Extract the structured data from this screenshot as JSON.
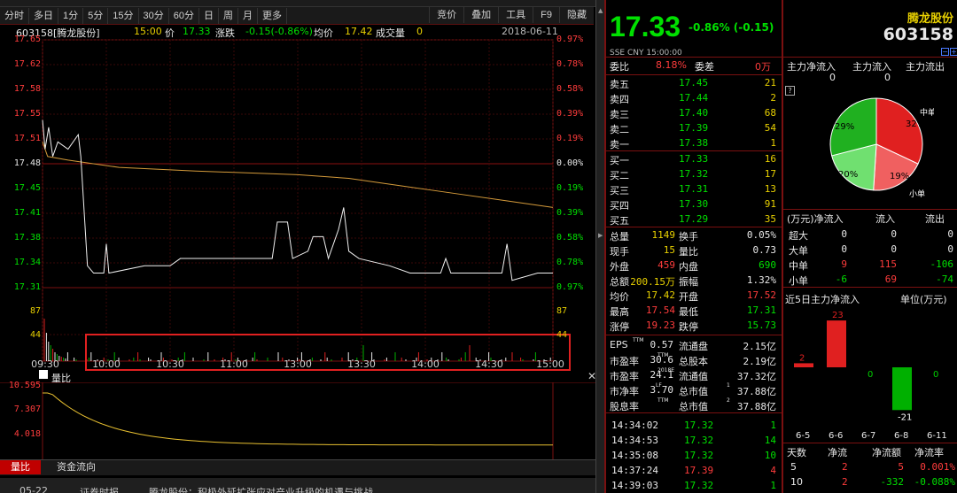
{
  "toolbar": {
    "left": [
      "分时",
      "多日",
      "1分",
      "5分",
      "15分",
      "30分",
      "60分",
      "日",
      "周",
      "月",
      "更多"
    ],
    "right": [
      "竞价",
      "叠加",
      "工具",
      "F9",
      "隐藏"
    ]
  },
  "info": {
    "code_name": "603158[腾龙股份]",
    "time": "15:00",
    "price_label": "价",
    "price": "17.33",
    "change_label": "涨跌",
    "change": "-0.15(-0.86%)",
    "avg_label": "均价",
    "avg": "17.42",
    "vol_label": "成交量",
    "vol": "0",
    "date": "2018-06-11"
  },
  "price_axis": {
    "left": [
      "17.65",
      "17.62",
      "17.58",
      "17.55",
      "17.51",
      "17.48",
      "17.45",
      "17.41",
      "17.38",
      "17.34",
      "17.31"
    ],
    "right": [
      "0.97%",
      "0.78%",
      "0.58%",
      "0.39%",
      "0.19%",
      "0.00%",
      "0.19%",
      "0.39%",
      "0.58%",
      "0.78%",
      "0.97%"
    ]
  },
  "volume_axis": {
    "left": [
      "87",
      "44"
    ],
    "right": [
      "87",
      "44"
    ]
  },
  "time_axis": [
    "09:30",
    "10:00",
    "10:30",
    "11:00",
    "13:00",
    "13:30",
    "14:00",
    "14:30",
    "15:00"
  ],
  "sub_chart": {
    "title": "量比",
    "ticks": [
      "10.595",
      "7.307",
      "4.018"
    ]
  },
  "bottom_tabs": [
    "量比",
    "资金流向"
  ],
  "news_strip": {
    "time": "05-22",
    "col": "证券时报",
    "text": "腾龙股份：积极外延扩张应对产业升级的机遇与挑战"
  },
  "quote": {
    "price": "17.33",
    "change": "-0.86% (-0.15)",
    "name": "腾龙股份",
    "code": "603158",
    "meta": "SSE  CNY   15:00:00",
    "weibi_label": "委比",
    "weibi": "8.18%",
    "weicha_label": "委差",
    "weicha": "0万"
  },
  "asks": [
    {
      "label": "卖五",
      "price": "17.45",
      "vol": "21"
    },
    {
      "label": "卖四",
      "price": "17.44",
      "vol": "2"
    },
    {
      "label": "卖三",
      "price": "17.40",
      "vol": "68"
    },
    {
      "label": "卖二",
      "price": "17.39",
      "vol": "54"
    },
    {
      "label": "卖一",
      "price": "17.38",
      "vol": "1"
    }
  ],
  "bids": [
    {
      "label": "买一",
      "price": "17.33",
      "vol": "16"
    },
    {
      "label": "买二",
      "price": "17.32",
      "vol": "17"
    },
    {
      "label": "买三",
      "price": "17.31",
      "vol": "13"
    },
    {
      "label": "买四",
      "price": "17.30",
      "vol": "91"
    },
    {
      "label": "买五",
      "price": "17.29",
      "vol": "35"
    }
  ],
  "stats": [
    {
      "l1": "总量",
      "v1": "1149",
      "l2": "换手",
      "v2": "0.05%"
    },
    {
      "l1": "现手",
      "v1": "15",
      "l2": "量比",
      "v2": "0.73"
    },
    {
      "l1": "外盘",
      "v1": "459",
      "l2": "内盘",
      "v2": "690"
    },
    {
      "l1": "总额",
      "v1": "200.15万",
      "l2": "振幅",
      "v2": "1.32%"
    },
    {
      "l1": "均价",
      "v1": "17.42",
      "l2": "开盘",
      "v2": "17.52"
    },
    {
      "l1": "最高",
      "v1": "17.54",
      "l2": "最低",
      "v2": "17.31"
    },
    {
      "l1": "涨停",
      "v1": "19.23",
      "l2": "跌停",
      "v2": "15.73"
    }
  ],
  "fundamentals": [
    {
      "l1": "EPS",
      "s1": "TTM",
      "v1": "0.57",
      "l2": "流通盘",
      "s2": "",
      "v2": "2.15亿"
    },
    {
      "l1": "市盈率",
      "s1": "TTM",
      "v1": "30.6",
      "l2": "总股本",
      "s2": "",
      "v2": "2.19亿"
    },
    {
      "l1": "市盈率",
      "s1": "2018E",
      "v1": "24.1",
      "l2": "流通值",
      "s2": "",
      "v2": "37.32亿"
    },
    {
      "l1": "市净率",
      "s1": "LF",
      "v1": "3.70",
      "l2": "总市值",
      "s2": "1",
      "v2": "37.88亿"
    },
    {
      "l1": "股息率",
      "s1": "TTM",
      "v1": "",
      "l2": "总市值",
      "s2": "2",
      "v2": "37.88亿"
    }
  ],
  "ticks": [
    {
      "time": "14:34:02",
      "price": "17.32",
      "vol": "1"
    },
    {
      "time": "14:34:53",
      "price": "17.32",
      "vol": "14"
    },
    {
      "time": "14:35:08",
      "price": "17.32",
      "vol": "10"
    },
    {
      "time": "14:37:24",
      "price": "17.39",
      "vol": "4"
    },
    {
      "time": "14:39:03",
      "price": "17.32",
      "vol": "1"
    }
  ],
  "flow_header": [
    "主力净流入",
    "主力流入",
    "主力流出"
  ],
  "flow_values": [
    "0",
    "0"
  ],
  "pie": {
    "slices": [
      {
        "pct": 32,
        "color": "#e02020",
        "label": "32%",
        "cat": "中单"
      },
      {
        "pct": 19,
        "color": "#f06060",
        "label": "19%",
        "cat": "小单"
      },
      {
        "pct": 20,
        "color": "#70e070",
        "label": "20%",
        "cat": "小单"
      },
      {
        "pct": 29,
        "color": "#20b020",
        "label": "29%",
        "cat": "中单"
      }
    ]
  },
  "flow_table": {
    "header": [
      "(万元)净流入",
      "流入",
      "流出"
    ],
    "rows": [
      {
        "name": "超大",
        "net": "0",
        "in": "0",
        "out": "0"
      },
      {
        "name": "大单",
        "net": "0",
        "in": "0",
        "out": "0"
      },
      {
        "name": "中单",
        "net": "9",
        "in": "115",
        "out": "-106"
      },
      {
        "name": "小单",
        "net": "-6",
        "in": "69",
        "out": "-74"
      }
    ]
  },
  "five_day": {
    "title": "近5日主力净流入",
    "unit": "单位(万元)",
    "dates": [
      "6-5",
      "6-6",
      "6-7",
      "6-8",
      "6-11"
    ],
    "values": [
      2,
      23,
      0,
      -21,
      0
    ],
    "labels": [
      "2",
      "23",
      "0",
      "-21",
      "0"
    ]
  },
  "summary": {
    "header": [
      "天数",
      "净流",
      "净流额",
      "净流率"
    ],
    "rows": [
      {
        "d": "5",
        "n": "2",
        "amt": "5",
        "rate": "0.001%"
      },
      {
        "d": "10",
        "n": "2",
        "amt": "-332",
        "rate": "-0.088%"
      }
    ]
  },
  "chart_data": {
    "type": "line",
    "x": [
      "09:30",
      "10:00",
      "10:30",
      "11:00",
      "13:00",
      "13:30",
      "14:00",
      "14:30",
      "15:00"
    ],
    "series": [],
    "ylim": [
      17.31,
      17.65
    ]
  }
}
